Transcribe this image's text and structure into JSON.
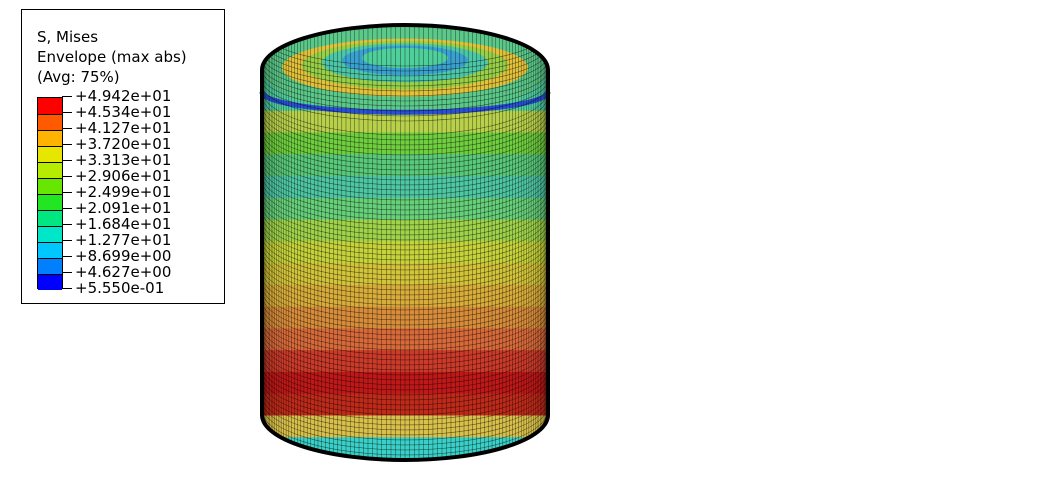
{
  "legend": {
    "title_line1": "S, Mises",
    "title_line2": "Envelope (max abs)",
    "title_line3": "(Avg: 75%)",
    "labels": [
      "+4.942e+01",
      "+4.534e+01",
      "+4.127e+01",
      "+3.720e+01",
      "+3.313e+01",
      "+2.906e+01",
      "+2.499e+01",
      "+2.091e+01",
      "+1.684e+01",
      "+1.277e+01",
      "+8.699e+00",
      "+4.627e+00",
      "+5.550e-01"
    ],
    "colors": [
      "#ff0000",
      "#ff5a00",
      "#ffb200",
      "#e6e600",
      "#b5ec00",
      "#66e600",
      "#23e623",
      "#00e680",
      "#00e6c8",
      "#00c8ff",
      "#0080ff",
      "#0000ff"
    ]
  },
  "model": {
    "band_colors": [
      "#4fcfa0",
      "#b9d14a",
      "#6fcf3f",
      "#59c97a",
      "#4ec7a3",
      "#66d07a",
      "#9fd44a",
      "#c6d33a",
      "#d3c43a",
      "#d9ad3a",
      "#d88d3a",
      "#d86a3a",
      "#cc3a2a",
      "#c01818",
      "#c02a1a",
      "#d8c04a",
      "#3ad0c8"
    ],
    "top_ring_color": "#2a4fd8",
    "mesh_color": "#000000"
  }
}
